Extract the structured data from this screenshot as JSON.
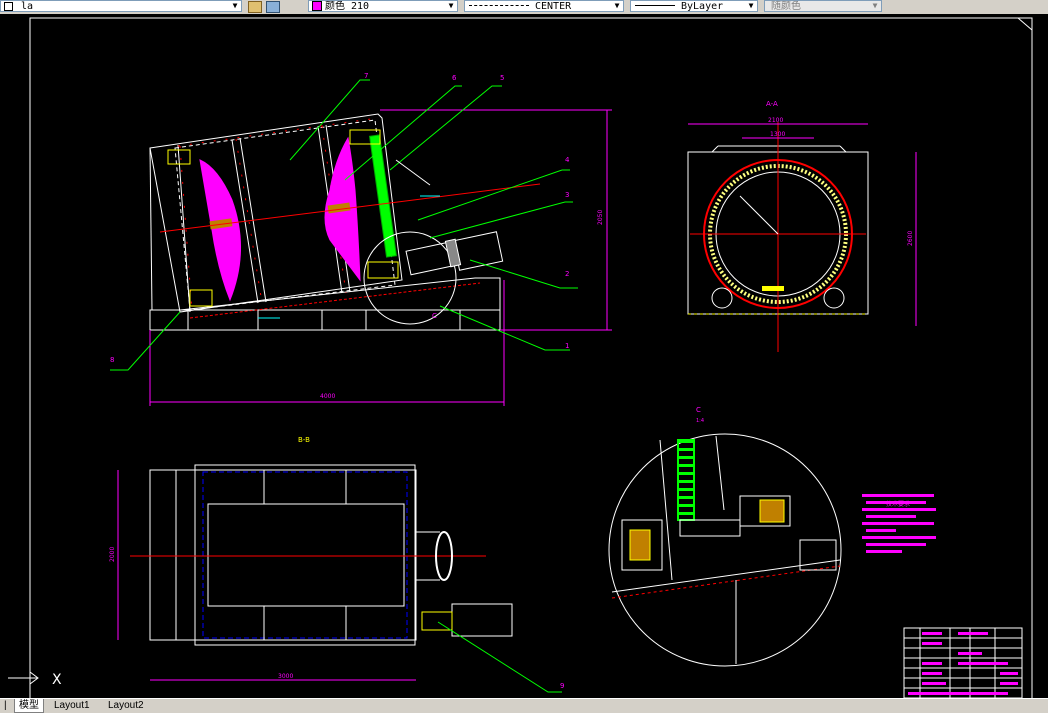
{
  "toolbar": {
    "layer_value": "la",
    "color_value": "颜色 210",
    "linetype_value": "CENTER",
    "lineweight_value": "ByLayer",
    "plotstyle_value": "随颜色",
    "color_swatch": "#ff00ff"
  },
  "drawing": {
    "section_aa": "A-A",
    "section_bb": "B-B",
    "detail_c": "C",
    "detail_c_scale": "1:4",
    "callouts": [
      "7",
      "6",
      "5",
      "4",
      "3",
      "2",
      "1",
      "8",
      "9"
    ],
    "dims": {
      "width_2100": "2100",
      "width_1300": "1300",
      "width_4000": "4000",
      "width_3000": "3000",
      "height_2050": "2050",
      "height_2000": "2000",
      "height_2600": "2600"
    },
    "tech_req_title": "技术要求",
    "colors": {
      "frame": "#ffffff",
      "magenta": "#ff00ff",
      "green": "#00ff00",
      "red": "#ff0000",
      "blue": "#0000ff",
      "yellow": "#ffff00",
      "cyan": "#00ffff"
    }
  },
  "tabs": {
    "model": "模型",
    "layout1": "Layout1",
    "layout2": "Layout2"
  },
  "ucs_icon": "X"
}
